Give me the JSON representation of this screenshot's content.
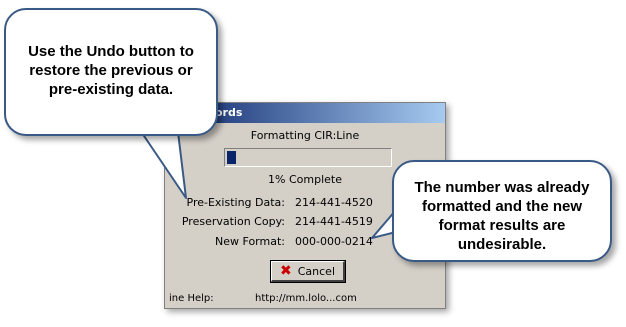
{
  "dialog": {
    "title": "ng Records",
    "formatting_label": "Formatting CIR:Line",
    "progress": {
      "fraction": 0.01,
      "text": "1% Complete"
    },
    "rows": [
      {
        "label": "Pre-Existing Data:",
        "value": "214-441-4520"
      },
      {
        "label": "Preservation Copy:",
        "value": "214-441-4519"
      },
      {
        "label": "New Format:",
        "value": "000-000-0214"
      }
    ],
    "cancel_label": "Cancel",
    "cancel_icon": "x-icon",
    "footer_left": "ine Help:",
    "footer_right": "http://mm.lolo...com"
  },
  "callouts": {
    "left": "Use the Undo button to restore the previous or pre-existing data.",
    "right": "The number was already formatted and the new format results are undesirable."
  },
  "colors": {
    "callout_border": "#3a5a86",
    "title_gradient_start": "#0a246a",
    "progress_fill": "#0a246a",
    "dialog_bg": "#d4d0c8"
  }
}
